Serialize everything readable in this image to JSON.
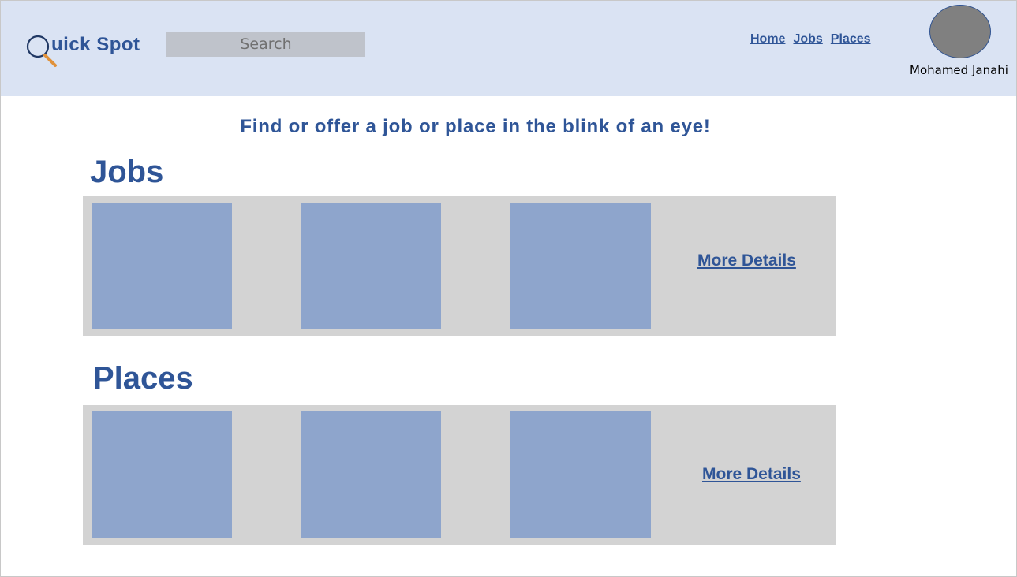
{
  "header": {
    "logo_text": "uick Spot",
    "search_placeholder": "Search",
    "nav": [
      "Home",
      "Jobs",
      "Places"
    ],
    "user_name": "Mohamed Janahi"
  },
  "tagline": "Find or offer a job or place in the blink of an eye!",
  "jobs": {
    "title": "Jobs",
    "more_label": "More Details"
  },
  "places": {
    "title": "Places",
    "more_label": "More Details"
  },
  "colors": {
    "header_bg": "#dae3f3",
    "brand_blue": "#2f5597",
    "card_blue": "#8ea5cc",
    "panel_gray": "#d3d3d3",
    "avatar_gray": "#808080",
    "magnifier_handle": "#e0913a"
  }
}
